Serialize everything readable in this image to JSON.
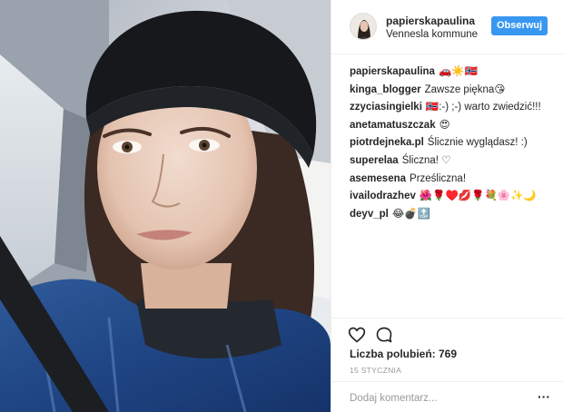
{
  "header": {
    "username": "papierskapaulina",
    "location": "Vennesla kommune",
    "follow_label": "Obserwuj"
  },
  "comments": [
    {
      "author": "papierskapaulina",
      "text": "🚗☀️🇳🇴"
    },
    {
      "author": "kinga_blogger",
      "text": "Zawsze piękna😘"
    },
    {
      "author": "zzyciasingielki",
      "text": "🇳🇴:-) ;-) warto zwiedzić!!!"
    },
    {
      "author": "anetamatuszczak",
      "text": "😍"
    },
    {
      "author": "piotrdejneka.pl",
      "text": "Ślicznie wyglądasz! :)"
    },
    {
      "author": "superelaa",
      "text": "Śliczna! ♡"
    },
    {
      "author": "asemesena",
      "text": "Prześliczna!"
    },
    {
      "author": "ivailodrazhev",
      "text": "🌺🌹♥️💋🌹💐🌸✨🌙"
    },
    {
      "author": "deyv_pl",
      "text": "😂💣🔝"
    }
  ],
  "actions": {
    "like_icon": "heart-icon",
    "comment_icon": "speech-bubble-icon",
    "likes_label": "Liczba polubień: 769",
    "date": "15 STYCZNIA"
  },
  "add_comment": {
    "placeholder": "Dodaj komentarz...",
    "more_label": "···"
  }
}
